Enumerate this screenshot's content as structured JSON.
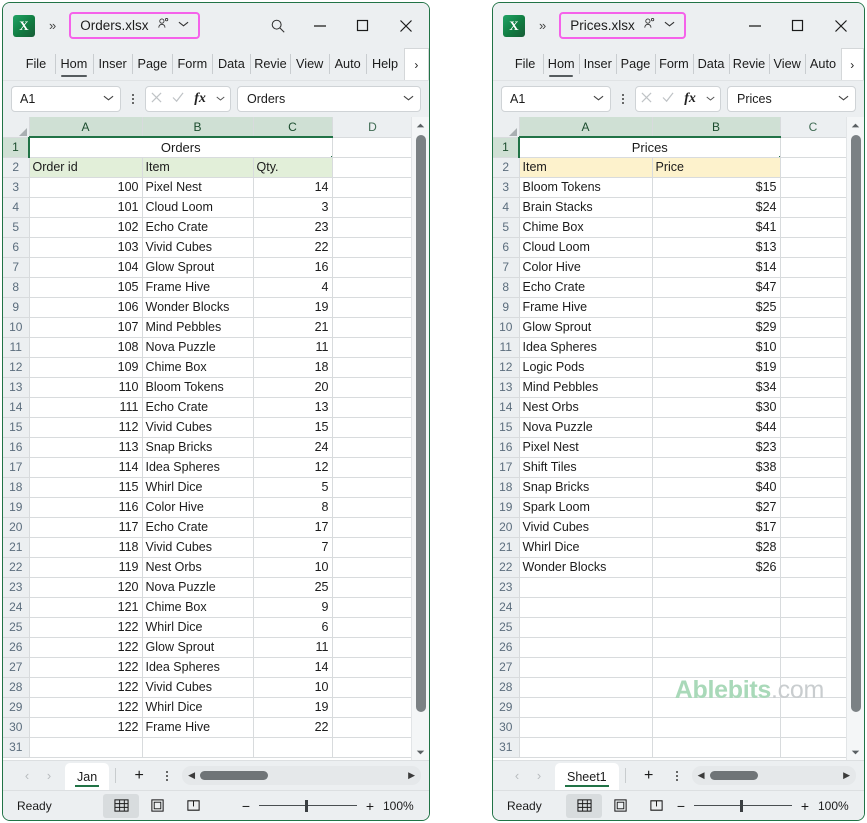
{
  "windows": {
    "left": {
      "filename": "Orders.xlsx",
      "logo_letter": "X",
      "overflow_chevron": "»",
      "has_search": true,
      "ribbon_tabs": [
        "File",
        "Hom",
        "Inser",
        "Page",
        "Form",
        "Data",
        "Revie",
        "View",
        "Auto",
        "Help"
      ],
      "ribbon_active": "Hom",
      "ribbon_overflow": "›",
      "namebox_value": "A1",
      "formula_value": "Orders",
      "fx_label": "fx",
      "columns": [
        "A",
        "B",
        "C",
        "D"
      ],
      "selected_col": "A",
      "sheet_title": "Orders",
      "table_headers": [
        "Order id",
        "Item",
        "Qty."
      ],
      "rows": [
        {
          "order_id": "100",
          "item": "Pixel Nest",
          "qty": "14"
        },
        {
          "order_id": "101",
          "item": "Cloud Loom",
          "qty": "3"
        },
        {
          "order_id": "102",
          "item": "Echo Crate",
          "qty": "23"
        },
        {
          "order_id": "103",
          "item": "Vivid Cubes",
          "qty": "22"
        },
        {
          "order_id": "104",
          "item": "Glow Sprout",
          "qty": "16"
        },
        {
          "order_id": "105",
          "item": "Frame Hive",
          "qty": "4"
        },
        {
          "order_id": "106",
          "item": "Wonder Blocks",
          "qty": "19"
        },
        {
          "order_id": "107",
          "item": "Mind Pebbles",
          "qty": "21"
        },
        {
          "order_id": "108",
          "item": "Nova Puzzle",
          "qty": "11"
        },
        {
          "order_id": "109",
          "item": "Chime Box",
          "qty": "18"
        },
        {
          "order_id": "110",
          "item": "Bloom Tokens",
          "qty": "20"
        },
        {
          "order_id": "111",
          "item": "Echo Crate",
          "qty": "13"
        },
        {
          "order_id": "112",
          "item": "Vivid Cubes",
          "qty": "15"
        },
        {
          "order_id": "113",
          "item": "Snap Bricks",
          "qty": "24"
        },
        {
          "order_id": "114",
          "item": "Idea Spheres",
          "qty": "12"
        },
        {
          "order_id": "115",
          "item": "Whirl Dice",
          "qty": "5"
        },
        {
          "order_id": "116",
          "item": "Color Hive",
          "qty": "8"
        },
        {
          "order_id": "117",
          "item": "Echo Crate",
          "qty": "17"
        },
        {
          "order_id": "118",
          "item": "Vivid Cubes",
          "qty": "7"
        },
        {
          "order_id": "119",
          "item": "Nest Orbs",
          "qty": "10"
        },
        {
          "order_id": "120",
          "item": "Nova Puzzle",
          "qty": "25"
        },
        {
          "order_id": "121",
          "item": "Chime Box",
          "qty": "9"
        },
        {
          "order_id": "122",
          "item": "Whirl Dice",
          "qty": "6"
        },
        {
          "order_id": "122",
          "item": "Glow Sprout",
          "qty": "11"
        },
        {
          "order_id": "122",
          "item": "Idea Spheres",
          "qty": "14"
        },
        {
          "order_id": "122",
          "item": "Vivid Cubes",
          "qty": "10"
        },
        {
          "order_id": "122",
          "item": "Whirl Dice",
          "qty": "19"
        },
        {
          "order_id": "122",
          "item": "Frame Hive",
          "qty": "22"
        }
      ],
      "first_row_number": 1,
      "last_row_number": 31,
      "sheet_tab": "Jan",
      "add_sheet": "+",
      "status": "Ready",
      "zoom": "100%",
      "header_fill": "#e2efd9"
    },
    "right": {
      "filename": "Prices.xlsx",
      "logo_letter": "X",
      "overflow_chevron": "»",
      "has_search": false,
      "ribbon_tabs": [
        "File",
        "Hom",
        "Inser",
        "Page",
        "Form",
        "Data",
        "Revie",
        "View",
        "Auto"
      ],
      "ribbon_active": "Hom",
      "ribbon_overflow": "›",
      "namebox_value": "A1",
      "formula_value": "Prices",
      "fx_label": "fx",
      "columns": [
        "A",
        "B",
        "C"
      ],
      "selected_col": "A",
      "sheet_title": "Prices",
      "table_headers": [
        "Item",
        "Price"
      ],
      "rows": [
        {
          "item": "Bloom Tokens",
          "price": "$15"
        },
        {
          "item": "Brain Stacks",
          "price": "$24"
        },
        {
          "item": "Chime Box",
          "price": "$41"
        },
        {
          "item": "Cloud Loom",
          "price": "$13"
        },
        {
          "item": "Color Hive",
          "price": "$14"
        },
        {
          "item": "Echo Crate",
          "price": "$47"
        },
        {
          "item": "Frame Hive",
          "price": "$25"
        },
        {
          "item": "Glow Sprout",
          "price": "$29"
        },
        {
          "item": "Idea Spheres",
          "price": "$10"
        },
        {
          "item": "Logic Pods",
          "price": "$19"
        },
        {
          "item": "Mind Pebbles",
          "price": "$34"
        },
        {
          "item": "Nest Orbs",
          "price": "$30"
        },
        {
          "item": "Nova Puzzle",
          "price": "$44"
        },
        {
          "item": "Pixel Nest",
          "price": "$23"
        },
        {
          "item": "Shift Tiles",
          "price": "$38"
        },
        {
          "item": "Snap Bricks",
          "price": "$40"
        },
        {
          "item": "Spark Loom",
          "price": "$27"
        },
        {
          "item": "Vivid Cubes",
          "price": "$17"
        },
        {
          "item": "Whirl Dice",
          "price": "$28"
        },
        {
          "item": "Wonder Blocks",
          "price": "$26"
        }
      ],
      "empty_rows": 9,
      "first_row_number": 1,
      "last_row_number": 31,
      "sheet_tab": "Sheet1",
      "add_sheet": "+",
      "status": "Ready",
      "zoom": "100%",
      "header_fill": "#fdf2cc"
    }
  },
  "watermark": {
    "brand": "Ablebits",
    "tld": ".com"
  },
  "colors": {
    "excel_green": "#217346",
    "highlight_pink": "#f562ea",
    "table_green_border": "#4c7a47",
    "table_gold_border": "#bf8f00"
  }
}
